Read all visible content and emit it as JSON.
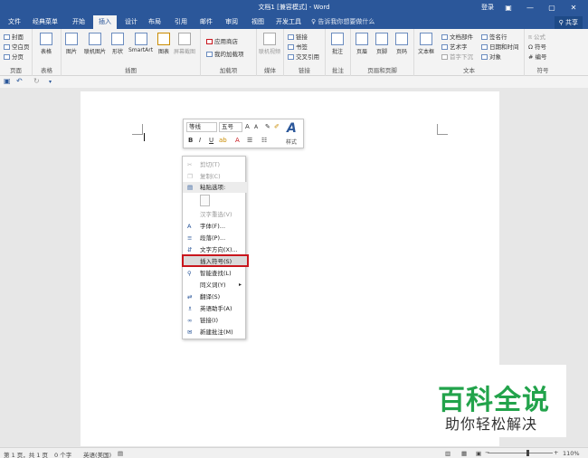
{
  "titlebar": {
    "title": "文档1 [兼容模式] - Word",
    "login": "登录",
    "min": "—",
    "max": "▢",
    "close": "✕"
  },
  "tabs": [
    "文件",
    "经典菜单",
    "开始",
    "插入",
    "设计",
    "布局",
    "引用",
    "邮件",
    "审阅",
    "视图",
    "开发工具"
  ],
  "active_tab": "插入",
  "tell_me": "告诉我你想要做什么",
  "share": "共享",
  "ribbon": {
    "groups": [
      "页面",
      "表格",
      "插图",
      "加载项",
      "媒体",
      "链接",
      "批注",
      "页眉和页脚",
      "文本",
      "符号"
    ],
    "pages_items": [
      "封面",
      "空白页",
      "分页"
    ],
    "table_label": "表格",
    "illus_items": [
      "图片",
      "联机图片",
      "形状",
      "SmartArt",
      "图表",
      "屏幕截图"
    ],
    "addins_items": [
      "应用商店",
      "我的加载项"
    ],
    "media_label": "联机视频",
    "links_items": [
      "链接",
      "书签",
      "交叉引用"
    ],
    "comment_label": "批注",
    "hf_items": [
      "页眉",
      "页脚",
      "页码"
    ],
    "text_items": [
      "文本框",
      "文档部件",
      "艺术字",
      "首字下沉",
      "签名行",
      "日期和时间",
      "对象"
    ],
    "symbol_items": [
      "公式",
      "符号",
      "编号"
    ]
  },
  "mini_toolbar": {
    "font": "等线",
    "size": "五号",
    "grow": "A",
    "shrink": "A",
    "bold": "B",
    "italic": "I",
    "underline": "U",
    "styles": "样式"
  },
  "context_menu": [
    {
      "label": "剪切(T)",
      "disabled": true
    },
    {
      "label": "复制(C)",
      "disabled": true
    },
    {
      "label": "粘贴选项:",
      "disabled": false
    },
    {
      "label": "",
      "disabled": false
    },
    {
      "label": "汉字重选(V)",
      "disabled": true
    },
    {
      "label": "字体(F)...",
      "disabled": false
    },
    {
      "label": "段落(P)...",
      "disabled": false
    },
    {
      "label": "文字方向(X)...",
      "disabled": false
    },
    {
      "label": "插入符号(S)",
      "disabled": false
    },
    {
      "label": "智能查找(L)",
      "disabled": false
    },
    {
      "label": "同义词(Y)",
      "disabled": false
    },
    {
      "label": "翻译(S)",
      "disabled": false
    },
    {
      "label": "英语助手(A)",
      "disabled": false
    },
    {
      "label": "链接(I)",
      "disabled": false
    },
    {
      "label": "新建批注(M)",
      "disabled": false
    }
  ],
  "watermark": {
    "title": "百科全说",
    "subtitle": "助你轻松解决"
  },
  "status": {
    "page": "第 1 页，共 1 页",
    "words": "0 个字",
    "lang": "英语(美国)",
    "zoom": "110%"
  }
}
